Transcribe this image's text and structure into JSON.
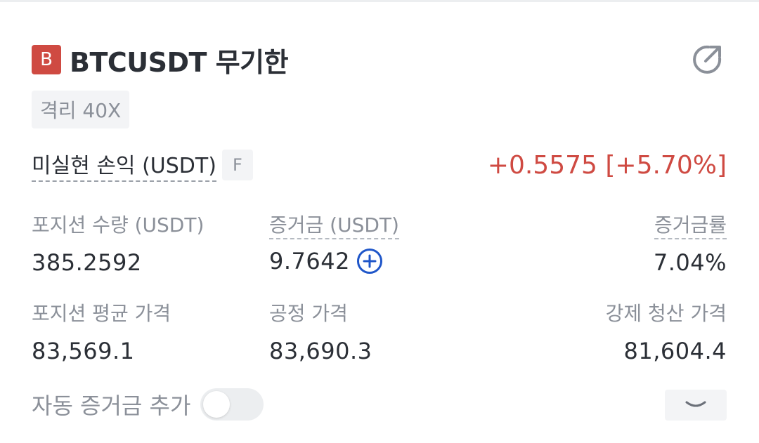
{
  "header": {
    "side_badge": "B",
    "title": "BTCUSDT 무기한",
    "share_icon": "share-arrow-icon"
  },
  "leverage": "격리 40X",
  "unrealized_pnl": {
    "label": "미실현 손익 (USDT)",
    "badge": "F",
    "value": "+0.5575 [+5.70%]"
  },
  "stats": {
    "position_size": {
      "label": "포지션 수량 (USDT)",
      "value": "385.2592"
    },
    "margin": {
      "label": "증거금 (USDT)",
      "value": "9.7642"
    },
    "margin_ratio": {
      "label": "증거금률",
      "value": "7.04%"
    },
    "entry_price": {
      "label": "포지션 평균 가격",
      "value": "83,569.1"
    },
    "mark_price": {
      "label": "공정 가격",
      "value": "83,690.3"
    },
    "liq_price": {
      "label": "강제 청산 가격",
      "value": "81,604.4"
    }
  },
  "auto_margin": {
    "label": "자동 증거금 추가",
    "enabled": false
  },
  "colors": {
    "sell_red": "#cf4a42",
    "accent_blue": "#1f56c9",
    "muted_text": "#8b9099",
    "primary_text": "#2b2f36"
  }
}
